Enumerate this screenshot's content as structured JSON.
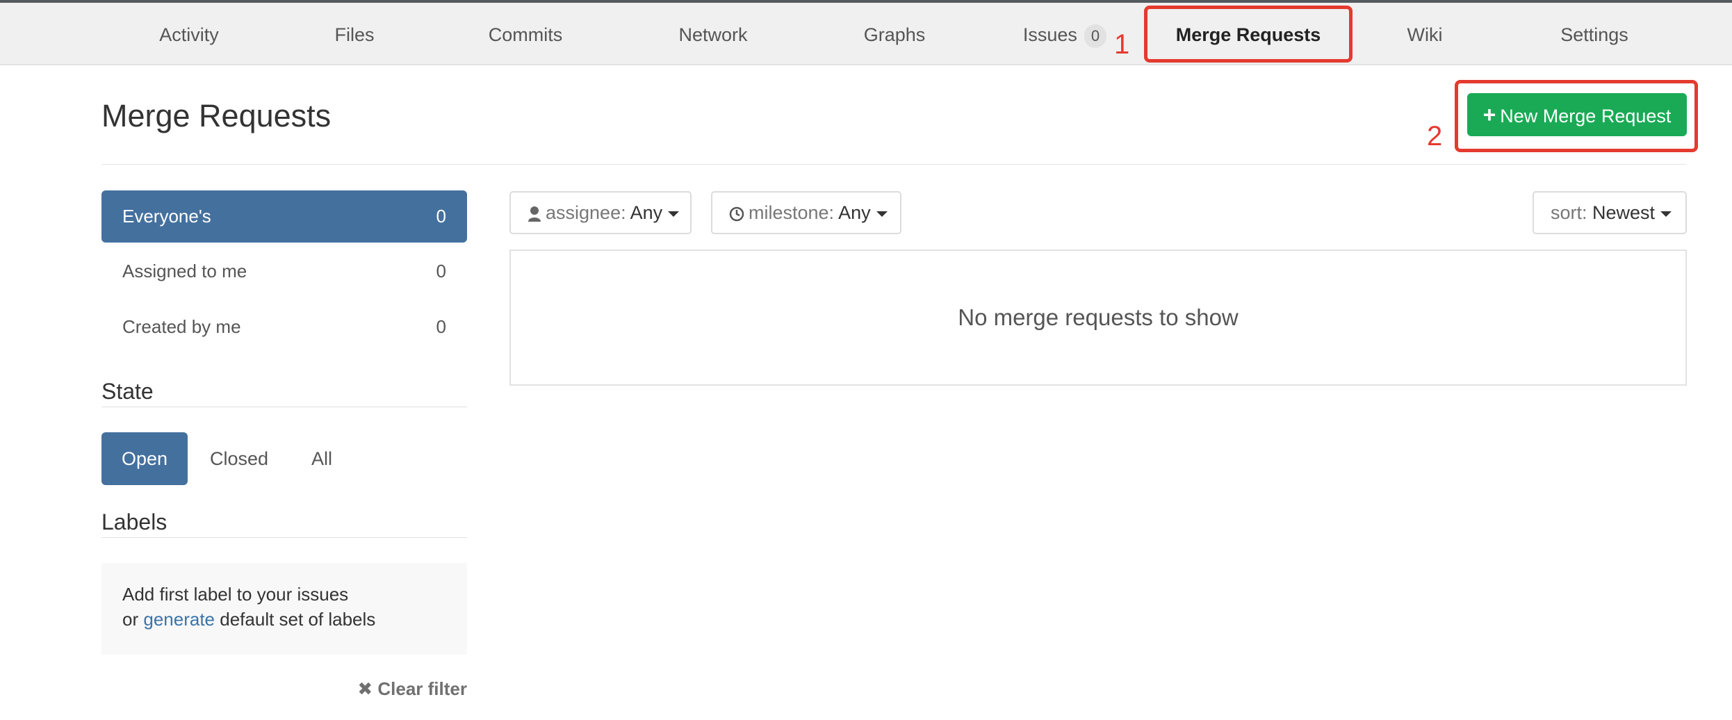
{
  "nav": {
    "tabs": [
      {
        "label": "Activity"
      },
      {
        "label": "Files"
      },
      {
        "label": "Commits"
      },
      {
        "label": "Network"
      },
      {
        "label": "Graphs"
      },
      {
        "label": "Issues",
        "badge": "0"
      },
      {
        "label": "Merge Requests",
        "active": true
      },
      {
        "label": "Wiki"
      },
      {
        "label": "Settings"
      }
    ]
  },
  "annotations": {
    "one": "1",
    "two": "2",
    "color": "#e53a2f"
  },
  "header": {
    "title": "Merge Requests",
    "new_button_icon": "plus-icon",
    "new_button_label": "New Merge Request",
    "new_button_color": "#1aaa55"
  },
  "sidebar": {
    "scopes": [
      {
        "label": "Everyone's",
        "count": "0",
        "active": true
      },
      {
        "label": "Assigned to me",
        "count": "0"
      },
      {
        "label": "Created by me",
        "count": "0"
      }
    ],
    "state_title": "State",
    "states": [
      {
        "label": "Open",
        "active": true
      },
      {
        "label": "Closed"
      },
      {
        "label": "All"
      }
    ],
    "labels_title": "Labels",
    "labels_line1": "Add first label to your issues",
    "labels_or": "or",
    "labels_link": "generate",
    "labels_rest": "default set of labels",
    "clear_filter": "Clear filter",
    "active_color": "#44709e"
  },
  "filters": {
    "assignee_label": "assignee:",
    "assignee_value": "Any",
    "milestone_label": "milestone:",
    "milestone_value": "Any",
    "sort_label": "sort:",
    "sort_value": "Newest"
  },
  "list": {
    "empty_message": "No merge requests to show"
  }
}
